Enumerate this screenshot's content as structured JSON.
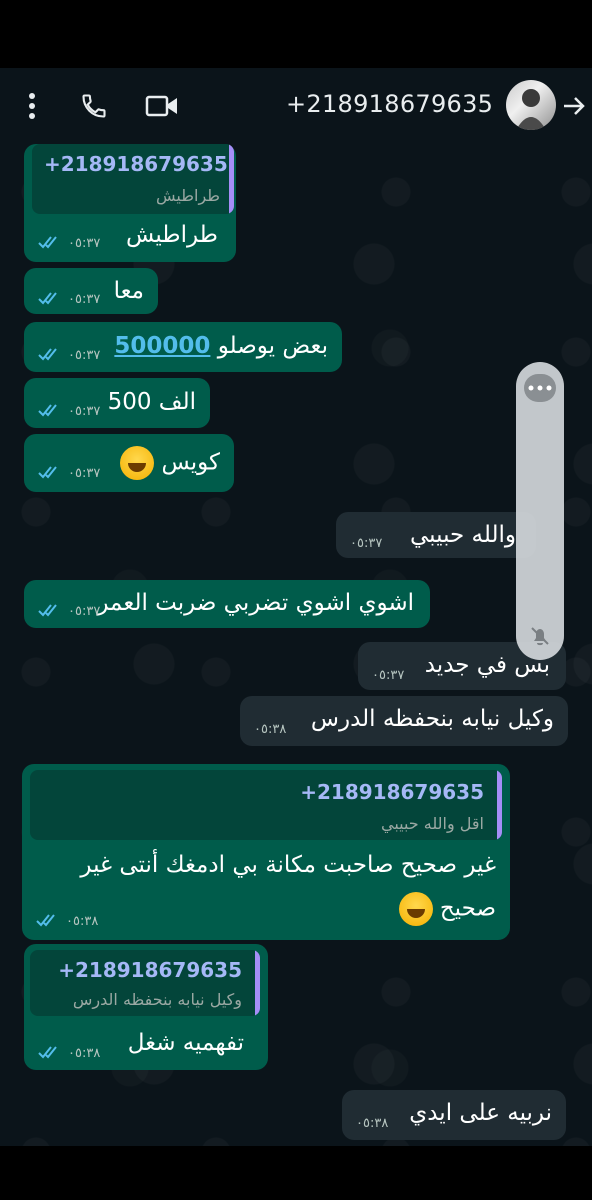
{
  "header": {
    "contact": "+218918679635",
    "icons": [
      "more-vert-icon",
      "phone-icon",
      "video-icon",
      "arrow-forward-icon"
    ]
  },
  "messages": [
    {
      "reply_name": "+218918679635",
      "reply_text": "طراطيش",
      "text": "طراطيش",
      "time": "٠٥:٣٧"
    },
    {
      "text": "معا",
      "time": "٠٥:٣٧"
    },
    {
      "text_before_link": "بعض يوصلو",
      "link": "500000",
      "time": "٠٥:٣٧"
    },
    {
      "text": "500 الف",
      "time": "٠٥:٣٧"
    },
    {
      "text": "كويس",
      "time": "٠٥:٣٧"
    },
    {
      "text": "والله حبيبي",
      "time": "٠٥:٣٧"
    },
    {
      "text": "اشوي اشوي تضربي ضربت العمر",
      "time": "٠٥:٣٧"
    },
    {
      "text": "بس في جديد",
      "time": "٠٥:٣٧"
    },
    {
      "text": "وكيل نيابه بنحفظه الدرس",
      "time": "٠٥:٣٨"
    },
    {
      "reply_name": "+218918679635",
      "reply_text": "اقل والله حبيبي",
      "text_line1": "غير صحيح صاحبت مكانة بي ادمغك أنتى غير",
      "text_line2": "صحيح",
      "time": "٠٥:٣٨"
    },
    {
      "reply_name": "+218918679635",
      "reply_text": "وكيل نيابه بنحفظه الدرس",
      "text": "تفهميه شغل",
      "time": "٠٥:٣٨"
    },
    {
      "text": "نربيه على ايدي",
      "time": "٠٥:٣٨"
    }
  ],
  "colors": {
    "outgoing": "#005c4b",
    "incoming": "#202c33",
    "tick": "#53bdeb",
    "link": "#53bdeb"
  }
}
